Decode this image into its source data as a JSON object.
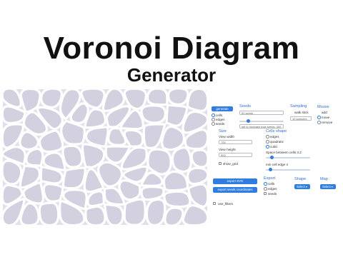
{
  "title": "Voronoi Diagram",
  "subtitle": "Generator",
  "controls": {
    "generate_label": "generate",
    "render": [
      "cells",
      "edges",
      "seeds"
    ],
    "seeds_header": "Seeds",
    "seeds_input_value": "50 seeds",
    "seeds_hint": "set to increase max seeds, 400",
    "sampling_header": "Sampling",
    "sampling_value": "walk stick",
    "samples_input_value": "10 samples",
    "mouse_header": "Mouse",
    "mouse_options": [
      "add",
      "move",
      "remove"
    ],
    "size_header": "Size",
    "view_width_label": "View width",
    "view_width_value": "700",
    "view_height_label": "View height",
    "view_height_value": "500",
    "show_grid_label": "show_grid",
    "cells_shape_header": "Cells shape",
    "cells_shape_options": [
      "edges",
      "quadratic",
      "cubic"
    ],
    "space_label": "Space between cells 3.2",
    "round_label": "min cell edge 4",
    "export_svg_label": "export SVG",
    "export_seeds_label": "export seeds coordinates",
    "export_header": "Export",
    "export_options": [
      "cells",
      "edges",
      "seeds"
    ],
    "shape_header": "Shape",
    "shape_select": "Select",
    "map_header": "Map",
    "map_select": "Select",
    "use_filters_label": "use_filters"
  },
  "colors": {
    "accent": "#2f7de1",
    "cell_fill": "#d3d0df",
    "canvas_bg": "#e2dfeb"
  }
}
